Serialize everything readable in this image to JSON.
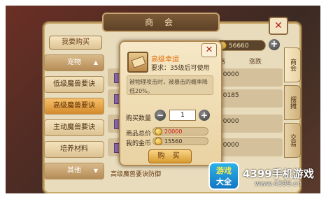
{
  "shop": {
    "title": "商 会",
    "want_button": "我要购买",
    "gold": "56660",
    "categories": [
      {
        "label": "宠物",
        "style": "group",
        "arrow": "▲"
      },
      {
        "label": "低级魔兽要诀",
        "style": "normal",
        "arrow": ""
      },
      {
        "label": "高级魔兽要诀",
        "style": "selected",
        "arrow": ""
      },
      {
        "label": "主动魔兽要诀",
        "style": "normal",
        "arrow": ""
      },
      {
        "label": "培养材料",
        "style": "normal",
        "arrow": ""
      },
      {
        "label": "其他",
        "style": "group",
        "arrow": "▼"
      }
    ],
    "columns": {
      "price": "价格",
      "change": "涨跌"
    },
    "rows": [
      {
        "price": "20000"
      },
      {
        "price": "20185"
      },
      {
        "price": "20000"
      },
      {
        "price": "20000"
      }
    ],
    "side_tabs": [
      "商会",
      "摆摊",
      "交易"
    ],
    "bottom_item": "高级魔兽要诀防御"
  },
  "popup": {
    "item_name": "高级幸运",
    "requirement": "要求：35级后可使用",
    "description": "被物理攻击时，被暴击的概率降低20%。",
    "qty_label": "购买数量",
    "qty_value": "1",
    "minus": "−",
    "plus": "+",
    "total_label": "商品总价",
    "total_value": "20000",
    "mine_label": "我的金币",
    "mine_value": "15560",
    "buy_label": "购 买",
    "close": "✕"
  },
  "brand": {
    "logo_line1": "游戏",
    "logo_line2": "大全",
    "name": "4399手机游戏",
    "url": "www.4399.cn"
  },
  "colors": {
    "accent": "#e26a00",
    "price_red": "#d21a10",
    "panel": "#e9dcbc"
  }
}
